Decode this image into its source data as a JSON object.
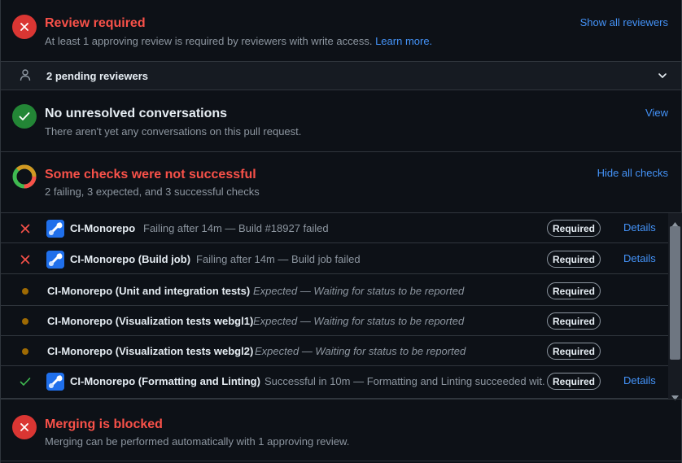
{
  "review": {
    "title": "Review required",
    "subtitle": "At least 1 approving review is required by reviewers with write access.",
    "learn_more": "Learn more.",
    "action": "Show all reviewers"
  },
  "pending": {
    "label": "2 pending reviewers"
  },
  "conversations": {
    "title": "No unresolved conversations",
    "subtitle": "There aren't yet any conversations on this pull request.",
    "action": "View"
  },
  "checks_summary": {
    "title": "Some checks were not successful",
    "subtitle": "2 failing, 3 expected, and 3 successful checks",
    "action": "Hide all checks"
  },
  "checks": [
    {
      "status": "failing",
      "name": "CI-Monorepo",
      "desc": "Failing after 14m — Build #18927 failed",
      "badge": "Required",
      "details": "Details"
    },
    {
      "status": "failing",
      "name": "CI-Monorepo (Build job)",
      "desc": "Failing after 14m — Build job failed",
      "badge": "Required",
      "details": "Details"
    },
    {
      "status": "expected",
      "name": "CI-Monorepo (Unit and integration tests)",
      "desc": "Expected — Waiting for status to be reported",
      "badge": "Required"
    },
    {
      "status": "expected",
      "name": "CI-Monorepo (Visualization tests webgl1)",
      "desc": "Expected — Waiting for status to be reported",
      "badge": "Required"
    },
    {
      "status": "expected",
      "name": "CI-Monorepo (Visualization tests webgl2)",
      "desc": "Expected — Waiting for status to be reported",
      "badge": "Required"
    },
    {
      "status": "success",
      "name": "CI-Monorepo (Formatting and Linting)",
      "desc": "Successful in 10m — Formatting and Linting succeeded wit...",
      "badge": "Required",
      "details": "Details"
    }
  ],
  "merge": {
    "title": "Merging is blocked",
    "subtitle": "Merging can be performed automatically with 1 approving review."
  },
  "colors": {
    "danger": "#f85149",
    "success": "#3fb950",
    "attention": "#9e6a03",
    "accent": "#4493f8"
  }
}
